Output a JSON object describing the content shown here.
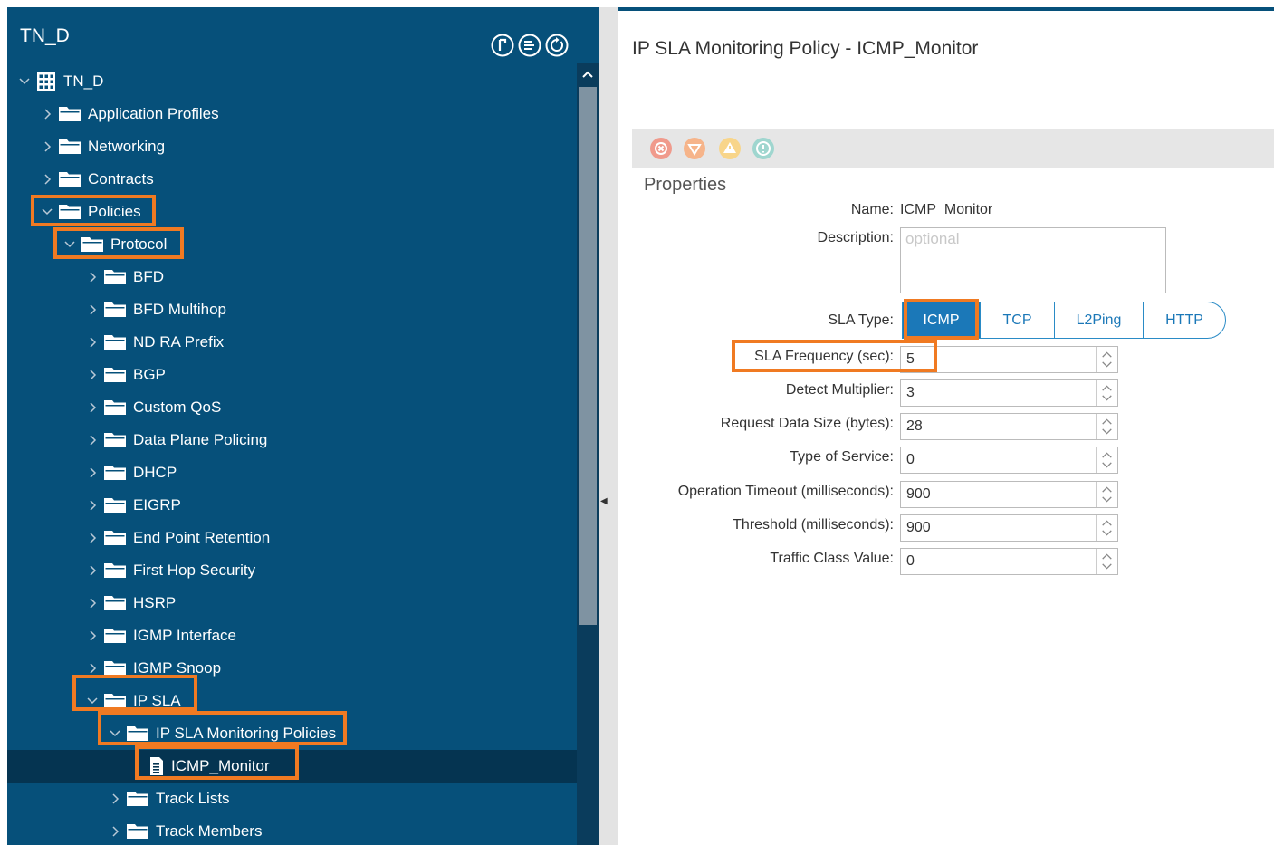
{
  "left_panel": {
    "title": "TN_D",
    "tree": [
      {
        "label": "TN_D",
        "icon": "building-icon",
        "expanded": true
      },
      {
        "label": "Application Profiles",
        "icon": "folder-icon",
        "expanded": false
      },
      {
        "label": "Networking",
        "icon": "folder-icon",
        "expanded": false
      },
      {
        "label": "Contracts",
        "icon": "folder-icon",
        "expanded": false
      },
      {
        "label": "Policies",
        "icon": "folder-icon",
        "expanded": true
      },
      {
        "label": "Protocol",
        "icon": "folder-icon",
        "expanded": true
      },
      {
        "label": "BFD",
        "icon": "folder-icon",
        "expanded": false
      },
      {
        "label": "BFD Multihop",
        "icon": "folder-icon",
        "expanded": false
      },
      {
        "label": "ND RA Prefix",
        "icon": "folder-icon",
        "expanded": false
      },
      {
        "label": "BGP",
        "icon": "folder-icon",
        "expanded": false
      },
      {
        "label": "Custom QoS",
        "icon": "folder-icon",
        "expanded": false
      },
      {
        "label": "Data Plane Policing",
        "icon": "folder-icon",
        "expanded": false
      },
      {
        "label": "DHCP",
        "icon": "folder-icon",
        "expanded": false
      },
      {
        "label": "EIGRP",
        "icon": "folder-icon",
        "expanded": false
      },
      {
        "label": "End Point Retention",
        "icon": "folder-icon",
        "expanded": false
      },
      {
        "label": "First Hop Security",
        "icon": "folder-icon",
        "expanded": false
      },
      {
        "label": "HSRP",
        "icon": "folder-icon",
        "expanded": false
      },
      {
        "label": "IGMP Interface",
        "icon": "folder-icon",
        "expanded": false
      },
      {
        "label": "IGMP Snoop",
        "icon": "folder-icon",
        "expanded": false
      },
      {
        "label": "IP SLA",
        "icon": "folder-icon",
        "expanded": true
      },
      {
        "label": "IP SLA Monitoring Policies",
        "icon": "folder-icon",
        "expanded": true
      },
      {
        "label": "ICMP_Monitor",
        "icon": "document-icon",
        "selected": true
      },
      {
        "label": "Track Lists",
        "icon": "folder-icon",
        "expanded": false
      },
      {
        "label": "Track Members",
        "icon": "folder-icon",
        "expanded": false
      }
    ]
  },
  "panel": {
    "title": "IP SLA Monitoring Policy - ICMP_Monitor",
    "section_title": "Properties",
    "name_label": "Name:",
    "name_value": "ICMP_Monitor",
    "description_label": "Description:",
    "description_placeholder": "optional",
    "sla_type_label": "SLA Type:",
    "sla_types": [
      "ICMP",
      "TCP",
      "L2Ping",
      "HTTP"
    ],
    "sla_type_selected": "ICMP",
    "fields": [
      {
        "label": "SLA Frequency (sec):",
        "value": "5"
      },
      {
        "label": "Detect Multiplier:",
        "value": "3"
      },
      {
        "label": "Request Data Size (bytes):",
        "value": "28"
      },
      {
        "label": "Type of Service:",
        "value": "0"
      },
      {
        "label": "Operation Timeout (milliseconds):",
        "value": "900"
      },
      {
        "label": "Threshold (milliseconds):",
        "value": "900"
      },
      {
        "label": "Traffic Class Value:",
        "value": "0"
      }
    ]
  },
  "colors": {
    "sidebar_bg": "#06507a",
    "highlight": "#f07a22",
    "accent": "#1b78b8",
    "fault_critical": "#f09a8c",
    "fault_major": "#f6b48a",
    "fault_minor": "#f8d58a",
    "fault_warning": "#9fd6cf"
  }
}
